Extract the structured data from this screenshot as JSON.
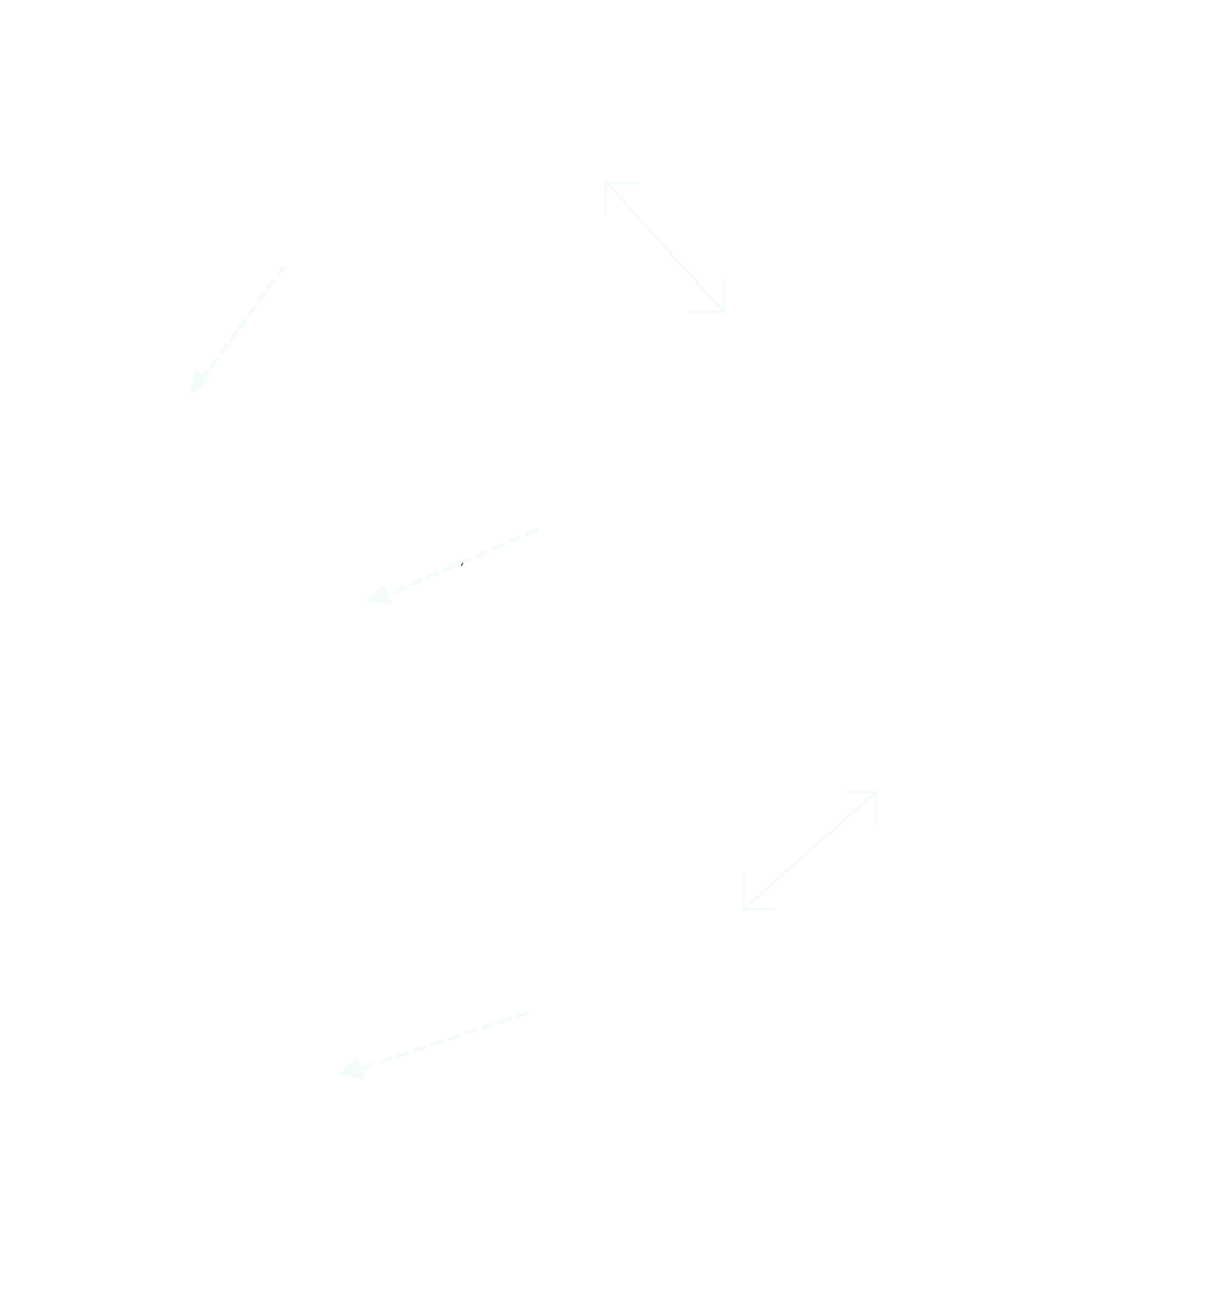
{
  "colors": {
    "background": "#ffffff",
    "arrow": "#f3fcf9",
    "mark": "#333333"
  },
  "arrows": [
    {
      "name": "dashed-arrow-upper-left",
      "style": "dashed",
      "heads": "end"
    },
    {
      "name": "double-arrow-upper-right",
      "style": "solid",
      "heads": "both"
    },
    {
      "name": "dashed-arrow-middle",
      "style": "dashed",
      "heads": "end"
    },
    {
      "name": "double-arrow-lower-right",
      "style": "solid",
      "heads": "both"
    },
    {
      "name": "dashed-arrow-bottom",
      "style": "dashed",
      "heads": "end"
    }
  ]
}
